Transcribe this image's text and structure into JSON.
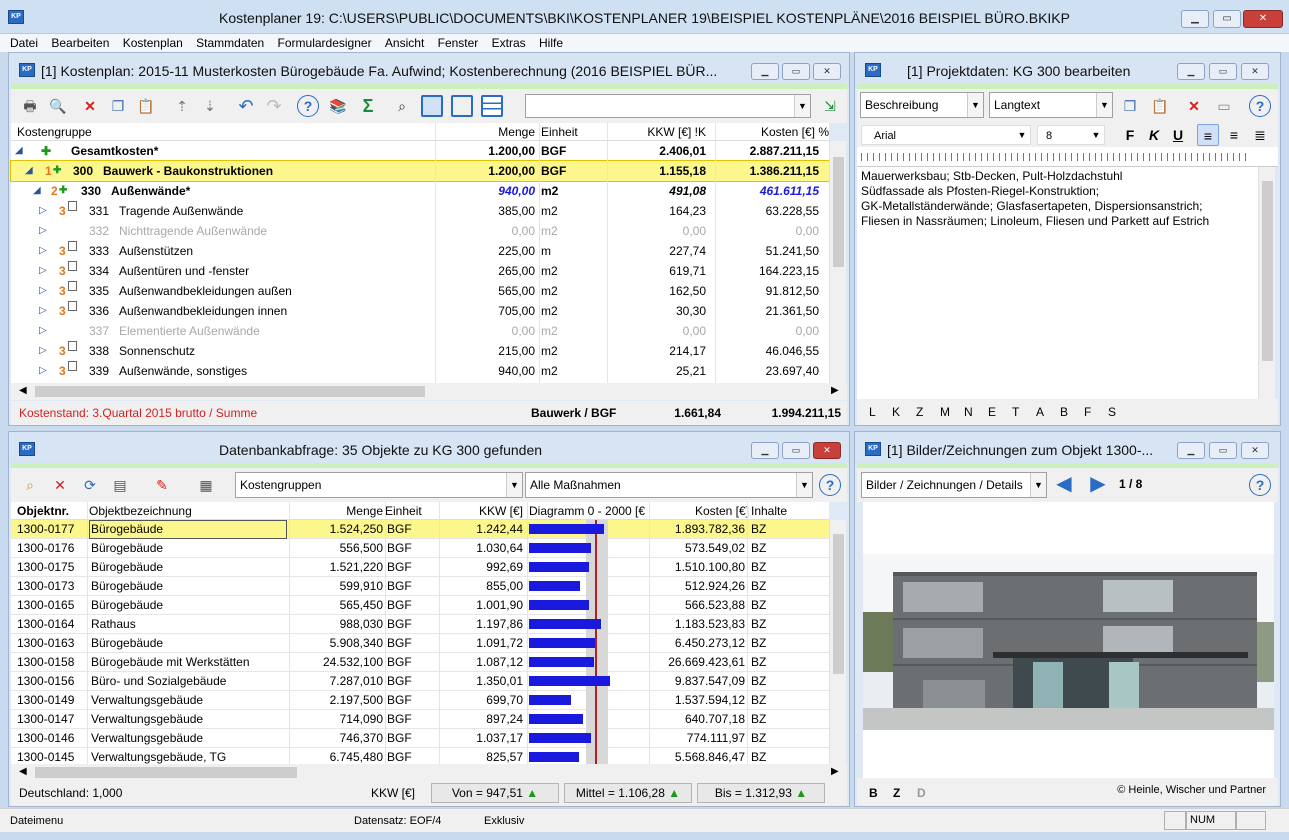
{
  "app": {
    "title": "Kostenplaner 19: C:\\USERS\\PUBLIC\\DOCUMENTS\\BKI\\KOSTENPLANER 19\\BEISPIEL KOSTENPLÄNE\\2016 BEISPIEL BÜRO.BKIKP",
    "icon_text": "KP"
  },
  "menu": [
    "Datei",
    "Bearbeiten",
    "Kostenplan",
    "Stammdaten",
    "Formulardesigner",
    "Ansicht",
    "Fenster",
    "Extras",
    "Hilfe"
  ],
  "cost_plan": {
    "title": "[1] Kostenplan: 2015-11 Musterkosten Bürogebäude Fa. Aufwind; Kostenberechnung  (2016 BEISPIEL BÜR...",
    "headers": {
      "group": "Kostengruppe",
      "qty": "Menge",
      "unit": "Einheit",
      "kkw": "KKW  [€] !K",
      "cost": "Kosten  [€] %"
    },
    "rows": [
      {
        "level": "",
        "code": "",
        "name": "Gesamtkosten*",
        "qty": "1.200,00",
        "unit": "BGF",
        "kkw": "2.406,01",
        "cost": "2.887.211,15"
      },
      {
        "level": "1",
        "code": "300",
        "name": "Bauwerk - Baukonstruktionen",
        "qty": "1.200,00",
        "unit": "BGF",
        "kkw": "1.155,18",
        "cost": "1.386.211,15"
      },
      {
        "level": "2",
        "code": "330",
        "name": "Außenwände*",
        "qty": "940,00",
        "unit": "m2",
        "kkw": "491,08",
        "cost": "461.611,15"
      },
      {
        "level": "3",
        "code": "331",
        "name": "Tragende Außenwände",
        "qty": "385,00",
        "unit": "m2",
        "kkw": "164,23",
        "cost": "63.228,55"
      },
      {
        "level": "",
        "code": "332",
        "name": "Nichttragende Außenwände",
        "qty": "0,00",
        "unit": "m2",
        "kkw": "0,00",
        "cost": "0,00"
      },
      {
        "level": "3",
        "code": "333",
        "name": "Außenstützen",
        "qty": "225,00",
        "unit": "m",
        "kkw": "227,74",
        "cost": "51.241,50"
      },
      {
        "level": "3",
        "code": "334",
        "name": "Außentüren und -fenster",
        "qty": "265,00",
        "unit": "m2",
        "kkw": "619,71",
        "cost": "164.223,15"
      },
      {
        "level": "3",
        "code": "335",
        "name": "Außenwandbekleidungen außen",
        "qty": "565,00",
        "unit": "m2",
        "kkw": "162,50",
        "cost": "91.812,50"
      },
      {
        "level": "3",
        "code": "336",
        "name": "Außenwandbekleidungen innen",
        "qty": "705,00",
        "unit": "m2",
        "kkw": "30,30",
        "cost": "21.361,50"
      },
      {
        "level": "",
        "code": "337",
        "name": "Elementierte Außenwände",
        "qty": "0,00",
        "unit": "m2",
        "kkw": "0,00",
        "cost": "0,00"
      },
      {
        "level": "3",
        "code": "338",
        "name": "Sonnenschutz",
        "qty": "215,00",
        "unit": "m2",
        "kkw": "214,17",
        "cost": "46.046,55"
      },
      {
        "level": "3",
        "code": "339",
        "name": "Außenwände, sonstiges",
        "qty": "940,00",
        "unit": "m2",
        "kkw": "25,21",
        "cost": "23.697,40"
      }
    ],
    "footer_left": "Kostenstand: 3.Quartal 2015 brutto / Summe",
    "footer_label": "Bauwerk / BGF",
    "footer_kkw": "1.661,84",
    "footer_cost": "1.994.211,15"
  },
  "project": {
    "title": "[1] Projektdaten: KG 300 bearbeiten",
    "field_select": "Beschreibung",
    "type_select": "Langtext",
    "font": "Arial",
    "size": "8",
    "fmt": [
      "F",
      "K",
      "U"
    ],
    "text_lines": [
      "Mauerwerksbau; Stb-Decken, Pult-Holzdachstuhl",
      "Südfassade als Pfosten-Riegel-Konstruktion;",
      "GK-Metallständerwände; Glasfasertapeten, Dispersionsanstrich;",
      "Fliesen in Nassräumen; Linoleum, Fliesen und Parkett auf Estrich"
    ],
    "letters": [
      "L",
      "K",
      "Z",
      "M",
      "N",
      "E",
      "T",
      "A",
      "B",
      "F",
      "S"
    ]
  },
  "db": {
    "title": "Datenbankabfrage: 35 Objekte zu KG 300 gefunden",
    "filter1": "Kostengruppen",
    "filter2": "Alle Maßnahmen",
    "headers": {
      "nr": "Objektnr.",
      "name": "Objektbezeichnung",
      "qty": "Menge",
      "unit": "Einheit",
      "kkw": "KKW  [€]",
      "chart": "Diagramm 0 - 2000 [€",
      "cost": "Kosten  [€]",
      "content": "Inhalte"
    },
    "rows": [
      {
        "nr": "1300-0177",
        "name": "Bürogebäude",
        "qty": "1.524,250",
        "unit": "BGF",
        "kkw": "1.242,44",
        "value": 1242.44,
        "cost": "1.893.782,36",
        "content": "BZ"
      },
      {
        "nr": "1300-0176",
        "name": "Bürogebäude",
        "qty": "556,500",
        "unit": "BGF",
        "kkw": "1.030,64",
        "value": 1030.64,
        "cost": "573.549,02",
        "content": "BZ"
      },
      {
        "nr": "1300-0175",
        "name": "Bürogebäude",
        "qty": "1.521,220",
        "unit": "BGF",
        "kkw": "992,69",
        "value": 992.69,
        "cost": "1.510.100,80",
        "content": "BZ"
      },
      {
        "nr": "1300-0173",
        "name": "Bürogebäude",
        "qty": "599,910",
        "unit": "BGF",
        "kkw": "855,00",
        "value": 855.0,
        "cost": "512.924,26",
        "content": "BZ"
      },
      {
        "nr": "1300-0165",
        "name": "Bürogebäude",
        "qty": "565,450",
        "unit": "BGF",
        "kkw": "1.001,90",
        "value": 1001.9,
        "cost": "566.523,88",
        "content": "BZ"
      },
      {
        "nr": "1300-0164",
        "name": "Rathaus",
        "qty": "988,030",
        "unit": "BGF",
        "kkw": "1.197,86",
        "value": 1197.86,
        "cost": "1.183.523,83",
        "content": "BZ"
      },
      {
        "nr": "1300-0163",
        "name": "Bürogebäude",
        "qty": "5.908,340",
        "unit": "BGF",
        "kkw": "1.091,72",
        "value": 1091.72,
        "cost": "6.450.273,12",
        "content": "BZ"
      },
      {
        "nr": "1300-0158",
        "name": "Bürogebäude mit Werkstätten",
        "qty": "24.532,100",
        "unit": "BGF",
        "kkw": "1.087,12",
        "value": 1087.12,
        "cost": "26.669.423,61",
        "content": "BZ"
      },
      {
        "nr": "1300-0156",
        "name": "Büro- und Sozialgebäude",
        "qty": "7.287,010",
        "unit": "BGF",
        "kkw": "1.350,01",
        "value": 1350.01,
        "cost": "9.837.547,09",
        "content": "BZ"
      },
      {
        "nr": "1300-0149",
        "name": "Verwaltungsgebäude",
        "qty": "2.197,500",
        "unit": "BGF",
        "kkw": "699,70",
        "value": 699.7,
        "cost": "1.537.594,12",
        "content": "BZ"
      },
      {
        "nr": "1300-0147",
        "name": "Verwaltungsgebäude",
        "qty": "714,090",
        "unit": "BGF",
        "kkw": "897,24",
        "value": 897.24,
        "cost": "640.707,18",
        "content": "BZ"
      },
      {
        "nr": "1300-0146",
        "name": "Verwaltungsgebäude",
        "qty": "746,370",
        "unit": "BGF",
        "kkw": "1.037,17",
        "value": 1037.17,
        "cost": "774.111,97",
        "content": "BZ"
      },
      {
        "nr": "1300-0145",
        "name": "Verwaltungsgebäude, TG",
        "qty": "6.745,480",
        "unit": "BGF",
        "kkw": "825,57",
        "value": 825.57,
        "cost": "5.568.846,47",
        "content": "BZ"
      }
    ],
    "footer_region": "Deutschland: 1,000",
    "footer_kkw": "KKW [€]",
    "von": "Von = 947,51",
    "mittel": "Mittel = 1.106,28",
    "bis": "Bis = 1.312,93",
    "range_min": 947.51,
    "range_mean": 1106.28,
    "range_max": 1312.93,
    "chart_max": 2000
  },
  "images": {
    "title": "[1] Bilder/Zeichnungen zum Objekt 1300-...",
    "select": "Bilder / Zeichnungen / Details",
    "page": "1 / 8",
    "credit": "© Heinle, Wischer und Partner",
    "letters": [
      "B",
      "Z",
      "D"
    ]
  },
  "status": {
    "left": "Dateimenu",
    "record": "Datensatz: EOF/4",
    "mode": "Exklusiv",
    "num": "NUM"
  },
  "colors": {
    "selection": "#fbf78c",
    "accent_blue": "#1a1ade",
    "header_green": "#ccf0bb",
    "red_text": "#d42020"
  }
}
